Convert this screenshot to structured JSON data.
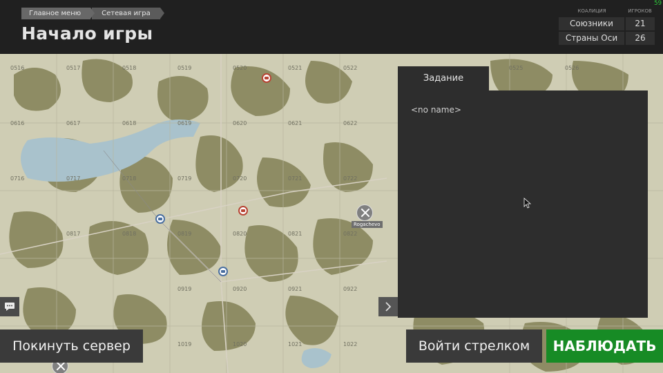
{
  "fps": "59",
  "breadcrumb": {
    "items": [
      "Главное меню",
      "Сетевая игра"
    ]
  },
  "header": {
    "title": "Начало игры"
  },
  "coalition": {
    "column_coalition": "КОАЛИЦИЯ",
    "column_players": "ИГРОКОВ",
    "rows": [
      {
        "name": "Союзники",
        "players": "21"
      },
      {
        "name": "Страны Оси",
        "players": "26"
      }
    ]
  },
  "map": {
    "grid_labels": [
      {
        "t": "0516"
      },
      {
        "t": "0517"
      },
      {
        "t": "0518"
      },
      {
        "t": "0519"
      },
      {
        "t": "0520"
      },
      {
        "t": "0521"
      },
      {
        "t": "0522"
      },
      {
        "t": "0525"
      },
      {
        "t": "0526"
      },
      {
        "t": "0616"
      },
      {
        "t": "0617"
      },
      {
        "t": "0618"
      },
      {
        "t": "0619"
      },
      {
        "t": "0620"
      },
      {
        "t": "0621"
      },
      {
        "t": "0622"
      },
      {
        "t": "0716"
      },
      {
        "t": "0717"
      },
      {
        "t": "0718"
      },
      {
        "t": "0719"
      },
      {
        "t": "0720"
      },
      {
        "t": "0721"
      },
      {
        "t": "0722"
      },
      {
        "t": "0817"
      },
      {
        "t": "0818"
      },
      {
        "t": "0819"
      },
      {
        "t": "0820"
      },
      {
        "t": "0821"
      },
      {
        "t": "0822"
      },
      {
        "t": "0919"
      },
      {
        "t": "0920"
      },
      {
        "t": "0921"
      },
      {
        "t": "0922"
      },
      {
        "t": "1019"
      },
      {
        "t": "1020"
      },
      {
        "t": "1021"
      },
      {
        "t": "1022"
      }
    ],
    "airfield_label": "Rogachevo"
  },
  "task": {
    "tab_label": "Задание",
    "text": "<no name>"
  },
  "buttons": {
    "leave": "Покинуть сервер",
    "join": "Войти стрелком",
    "spectate": "НАБЛЮДАТЬ"
  }
}
